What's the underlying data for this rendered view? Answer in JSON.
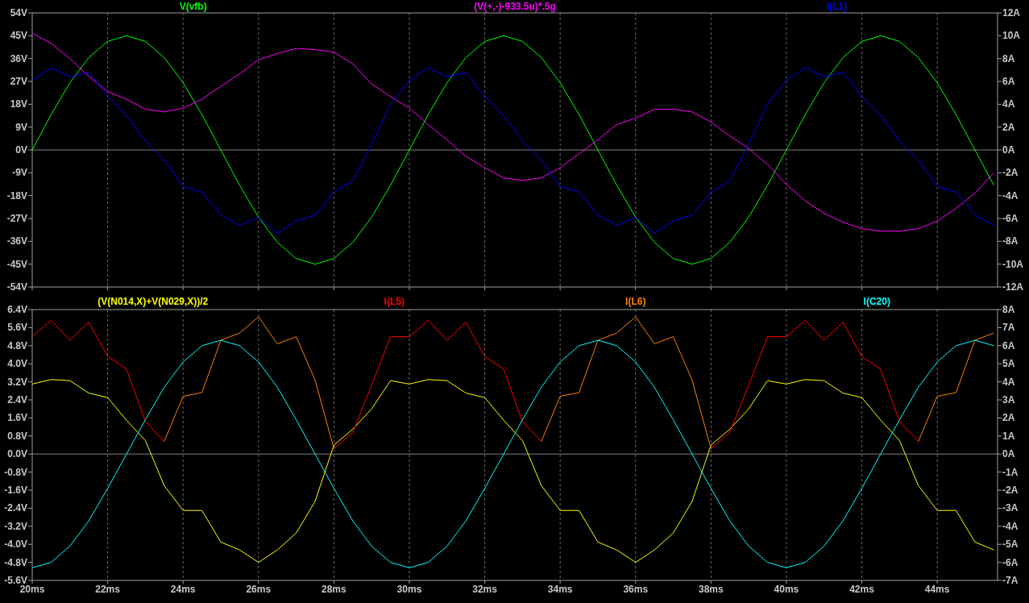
{
  "panes": [
    {
      "chart_data": {
        "type": "line",
        "grid": true,
        "xlim": [
          20,
          45.6
        ],
        "ylim": [
          -54,
          54
        ],
        "y2lim": [
          -12,
          12
        ],
        "yticks": [
          {
            "value": 54,
            "label": "54V"
          },
          {
            "value": 45,
            "label": "45V"
          },
          {
            "value": 36,
            "label": "36V"
          },
          {
            "value": 27,
            "label": "27V"
          },
          {
            "value": 18,
            "label": "18V"
          },
          {
            "value": 9,
            "label": "9V"
          },
          {
            "value": 0,
            "label": "0V"
          },
          {
            "value": -9,
            "label": "-9V"
          },
          {
            "value": -18,
            "label": "-18V"
          },
          {
            "value": -27,
            "label": "-27V"
          },
          {
            "value": -36,
            "label": "-36V"
          },
          {
            "value": -45,
            "label": "-45V"
          },
          {
            "value": -54,
            "label": "-54V"
          }
        ],
        "y2ticks": [
          {
            "value": 12,
            "label": "12A"
          },
          {
            "value": 10,
            "label": "10A"
          },
          {
            "value": 8,
            "label": "8A"
          },
          {
            "value": 6,
            "label": "6A"
          },
          {
            "value": 4,
            "label": "4A"
          },
          {
            "value": 2,
            "label": "2A"
          },
          {
            "value": 0,
            "label": "0A"
          },
          {
            "value": -2,
            "label": "-2A"
          },
          {
            "value": -4,
            "label": "-4A"
          },
          {
            "value": -6,
            "label": "-6A"
          },
          {
            "value": -8,
            "label": "-8A"
          },
          {
            "value": -10,
            "label": "-10A"
          },
          {
            "value": -12,
            "label": "-12A"
          }
        ],
        "x": [
          20,
          20.5,
          21,
          21.5,
          22,
          22.5,
          23,
          23.5,
          24,
          24.5,
          25,
          25.5,
          26,
          26.5,
          27,
          27.5,
          28,
          28.5,
          29,
          29.5,
          30,
          30.5,
          31,
          31.5,
          32,
          32.5,
          33,
          33.5,
          34,
          34.5,
          35,
          35.5,
          36,
          36.5,
          37,
          37.5,
          38,
          38.5,
          39,
          39.5,
          40,
          40.5,
          41,
          41.5,
          42,
          42.5,
          43,
          43.5,
          44,
          44.5,
          45,
          45.5
        ],
        "series": [
          {
            "name": "V(vfb)",
            "color": "#00ff00",
            "values": [
              0,
              13.9,
              26.5,
              36.4,
              42.8,
              45,
              42.8,
              36.4,
              26.5,
              13.9,
              0,
              -13.9,
              -26.5,
              -36.4,
              -42.8,
              -45,
              -42.8,
              -36.4,
              -26.5,
              -13.9,
              0,
              13.9,
              26.5,
              36.4,
              42.8,
              45,
              42.8,
              36.4,
              26.5,
              13.9,
              0,
              -13.9,
              -26.5,
              -36.4,
              -42.8,
              -45,
              -42.8,
              -36.4,
              -26.5,
              -13.9,
              0,
              13.9,
              26.5,
              36.4,
              42.8,
              45,
              42.8,
              36.4,
              26.5,
              13.9,
              0,
              -13.9
            ]
          },
          {
            "name": "(V(+,-)-933.5u)*.5g",
            "color": "#ff00ff",
            "values": [
              46,
              42,
              36,
              29,
              23,
              20,
              16,
              15,
              16.5,
              20,
              25,
              30,
              35.5,
              38,
              40,
              39.5,
              38.5,
              34,
              26,
              21,
              16.5,
              10,
              4,
              -2.5,
              -7,
              -11,
              -12,
              -11,
              -7,
              -1.5,
              4,
              10,
              12.5,
              16,
              16,
              15,
              11,
              5.5,
              0.6,
              -5.7,
              -13.6,
              -20,
              -25,
              -28.5,
              -31,
              -32,
              -32,
              -31,
              -28,
              -23,
              -17,
              -9
            ]
          },
          {
            "name": "I(L1)",
            "color": "#0000ff",
            "axis": "y2",
            "values": [
              6.1,
              7.2,
              6.4,
              6.8,
              4.7,
              3.0,
              0.8,
              -0.9,
              -3.2,
              -3.7,
              -5.7,
              -6.6,
              -5.9,
              -7.3,
              -6.2,
              -5.7,
              -3.7,
              -2.7,
              0.5,
              4.0,
              6.1,
              7.2,
              6.4,
              6.8,
              4.7,
              3.0,
              0.8,
              -0.9,
              -3.2,
              -3.7,
              -5.7,
              -6.6,
              -5.9,
              -7.3,
              -6.2,
              -5.7,
              -3.7,
              -2.7,
              0.5,
              4.0,
              6.1,
              7.2,
              6.4,
              6.8,
              4.7,
              3.0,
              0.8,
              -0.9,
              -3.2,
              -3.7,
              -5.7,
              -6.6
            ]
          }
        ]
      }
    },
    {
      "chart_data": {
        "type": "line",
        "grid": true,
        "xlim": [
          20,
          45.6
        ],
        "ylim": [
          -5.6,
          6.4
        ],
        "y2lim": [
          -7,
          8
        ],
        "xticks": [
          {
            "value": 20,
            "label": "20ms"
          },
          {
            "value": 22,
            "label": "22ms"
          },
          {
            "value": 24,
            "label": "24ms"
          },
          {
            "value": 26,
            "label": "26ms"
          },
          {
            "value": 28,
            "label": "28ms"
          },
          {
            "value": 30,
            "label": "30ms"
          },
          {
            "value": 32,
            "label": "32ms"
          },
          {
            "value": 34,
            "label": "34ms"
          },
          {
            "value": 36,
            "label": "36ms"
          },
          {
            "value": 38,
            "label": "38ms"
          },
          {
            "value": 40,
            "label": "40ms"
          },
          {
            "value": 42,
            "label": "42ms"
          },
          {
            "value": 44,
            "label": "44ms"
          }
        ],
        "yticks": [
          {
            "value": 6.4,
            "label": "6.4V"
          },
          {
            "value": 5.6,
            "label": "5.6V"
          },
          {
            "value": 4.8,
            "label": "4.8V"
          },
          {
            "value": 4.0,
            "label": "4.0V"
          },
          {
            "value": 3.2,
            "label": "3.2V"
          },
          {
            "value": 2.4,
            "label": "2.4V"
          },
          {
            "value": 1.6,
            "label": "1.6V"
          },
          {
            "value": 0.8,
            "label": "0.8V"
          },
          {
            "value": 0,
            "label": "0.0V"
          },
          {
            "value": -0.8,
            "label": "-0.8V"
          },
          {
            "value": -1.6,
            "label": "-1.6V"
          },
          {
            "value": -2.4,
            "label": "-2.4V"
          },
          {
            "value": -3.2,
            "label": "-3.2V"
          },
          {
            "value": -4.0,
            "label": "-4.0V"
          },
          {
            "value": -4.8,
            "label": "-4.8V"
          },
          {
            "value": -5.6,
            "label": "-5.6V"
          }
        ],
        "y2ticks": [
          {
            "value": 8,
            "label": "8A"
          },
          {
            "value": 7,
            "label": "7A"
          },
          {
            "value": 6,
            "label": "6A"
          },
          {
            "value": 5,
            "label": "5A"
          },
          {
            "value": 4,
            "label": "4A"
          },
          {
            "value": 3,
            "label": "3A"
          },
          {
            "value": 2,
            "label": "2A"
          },
          {
            "value": 1,
            "label": "1A"
          },
          {
            "value": 0,
            "label": "0A"
          },
          {
            "value": -1,
            "label": "-1A"
          },
          {
            "value": -2,
            "label": "-2A"
          },
          {
            "value": -3,
            "label": "-3A"
          },
          {
            "value": -4,
            "label": "-4A"
          },
          {
            "value": -5,
            "label": "-5A"
          },
          {
            "value": -6,
            "label": "-6A"
          },
          {
            "value": -7,
            "label": "-7A"
          }
        ],
        "x": [
          20,
          20.5,
          21,
          21.5,
          22,
          22.5,
          23,
          23.5,
          24,
          24.5,
          25,
          25.5,
          26,
          26.5,
          27,
          27.5,
          28,
          28.5,
          29,
          29.5,
          30,
          30.5,
          31,
          31.5,
          32,
          32.5,
          33,
          33.5,
          34,
          34.5,
          35,
          35.5,
          36,
          36.5,
          37,
          37.5,
          38,
          38.5,
          39,
          39.5,
          40,
          40.5,
          41,
          41.5,
          42,
          42.5,
          43,
          43.5,
          44,
          44.5,
          45,
          45.5
        ],
        "series": [
          {
            "name": "(V(N014,X)+V(N029,X))/2",
            "color": "#ffff00",
            "values": [
              3.1,
              3.3,
              3.25,
              2.7,
              2.5,
              1.5,
              0.6,
              -1.4,
              -2.5,
              -2.5,
              -3.9,
              -4.25,
              -4.8,
              -4.25,
              -3.5,
              -2.1,
              0.4,
              1.1,
              2.0,
              3.25,
              3.1,
              3.3,
              3.25,
              2.7,
              2.5,
              1.5,
              0.6,
              -1.4,
              -2.5,
              -2.5,
              -3.9,
              -4.25,
              -4.8,
              -4.25,
              -3.5,
              -2.1,
              0.4,
              1.1,
              2.0,
              3.25,
              3.1,
              3.3,
              3.25,
              2.7,
              2.5,
              1.5,
              0.6,
              -1.4,
              -2.5,
              -2.5,
              -3.9,
              -4.25
            ]
          },
          {
            "name": "I(L5)",
            "color": "#ff0000",
            "axis": "y2",
            "values": [
              6.5,
              7.4,
              6.3,
              7.3,
              5.4,
              4.7,
              1.8,
              0.7,
              null,
              null,
              null,
              null,
              null,
              null,
              null,
              null,
              0.3,
              1.2,
              3.8,
              6.5,
              6.5,
              7.4,
              6.3,
              7.3,
              5.4,
              4.7,
              1.8,
              0.7,
              null,
              null,
              null,
              null,
              null,
              null,
              null,
              null,
              0.3,
              1.2,
              3.8,
              6.5,
              6.5,
              7.4,
              6.3,
              7.3,
              5.4,
              4.7,
              1.8,
              0.7,
              null,
              null,
              null,
              null
            ]
          },
          {
            "name": "I(L6)",
            "color": "#ff8000",
            "axis": "y2",
            "values": [
              null,
              null,
              null,
              null,
              null,
              null,
              null,
              0.7,
              3.2,
              3.4,
              6.3,
              6.7,
              7.6,
              6.1,
              6.5,
              4.1,
              0.3,
              null,
              null,
              null,
              null,
              null,
              null,
              null,
              null,
              null,
              null,
              0.7,
              3.2,
              3.4,
              6.3,
              6.7,
              7.6,
              6.1,
              6.5,
              4.1,
              0.3,
              null,
              null,
              null,
              null,
              null,
              null,
              null,
              null,
              null,
              null,
              0.7,
              3.2,
              3.4,
              6.3,
              6.7
            ]
          },
          {
            "name": "I(C20)",
            "color": "#00ffff",
            "axis": "y2",
            "values": [
              -6.3,
              -6.0,
              -5.1,
              -3.7,
              -1.9,
              0,
              1.9,
              3.7,
              5.1,
              6.0,
              6.3,
              6.0,
              5.1,
              3.7,
              1.9,
              0,
              -1.9,
              -3.7,
              -5.1,
              -6.0,
              -6.3,
              -6.0,
              -5.1,
              -3.7,
              -1.9,
              0,
              1.9,
              3.7,
              5.1,
              6.0,
              6.3,
              6.0,
              5.1,
              3.7,
              1.9,
              0,
              -1.9,
              -3.7,
              -5.1,
              -6.0,
              -6.3,
              -6.0,
              -5.1,
              -3.7,
              -1.9,
              0,
              1.9,
              3.7,
              5.1,
              6.0,
              6.3,
              6.0
            ]
          }
        ]
      }
    }
  ]
}
